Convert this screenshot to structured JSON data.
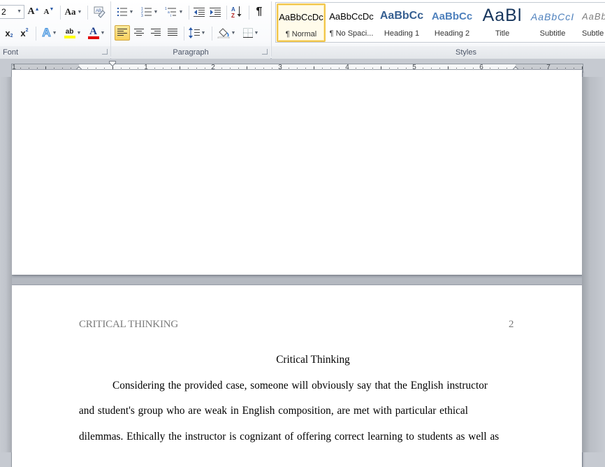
{
  "ribbon": {
    "font_group": {
      "label": "Font",
      "font_size": "2",
      "grow_font": "A",
      "shrink_font": "A",
      "change_case": "Aa",
      "subscript": "x",
      "subscript_mark": "2",
      "superscript": "x",
      "superscript_mark": "2",
      "text_effects": "A",
      "highlight": "ab",
      "font_color": "A",
      "highlight_color": "#ffff00",
      "font_color_value": "#ff0000"
    },
    "paragraph_group": {
      "label": "Paragraph",
      "show_marks": "¶",
      "sort": "A↓",
      "active_alignment": "align-left"
    },
    "styles_group": {
      "label": "Styles",
      "styles": [
        {
          "preview": "AaBbCcDc",
          "name": "¶ Normal",
          "selected": true
        },
        {
          "preview": "AaBbCcDc",
          "name": "¶ No Spaci...",
          "selected": false
        },
        {
          "preview": "AaBbCc",
          "name": "Heading 1",
          "selected": false
        },
        {
          "preview": "AaBbCc",
          "name": "Heading 2",
          "selected": false
        },
        {
          "preview": "AaBl",
          "name": "Title",
          "selected": false
        },
        {
          "preview": "AaBbCcI",
          "name": "Subtitle",
          "selected": false
        },
        {
          "preview": "AaBb",
          "name": "Subtle",
          "selected": false
        }
      ]
    }
  },
  "ruler": {
    "numbers": [
      "1",
      "1",
      "2",
      "3",
      "4",
      "5",
      "6",
      "7"
    ]
  },
  "document": {
    "header": {
      "running_head": "CRITICAL THINKING",
      "page_number": "2"
    },
    "title": "Critical Thinking",
    "lines": [
      "Considering the provided case, someone will obviously say that the English instructor",
      "and student's group who are weak in English composition, are met with particular ethical",
      "dilemmas. Ethically the instructor is cognizant of offering correct learning to students as well as"
    ]
  },
  "colors": {
    "ribbon_active": "#f9d15e",
    "heading_blue": "#365f91",
    "subtitle_blue": "#4f81bd",
    "header_gray": "#7b7b7b"
  }
}
